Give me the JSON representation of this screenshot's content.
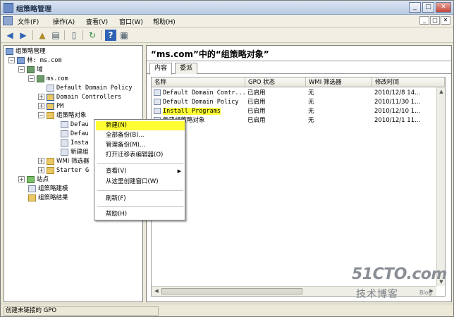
{
  "window": {
    "title": "组策略管理",
    "caption_min": "_",
    "caption_max": "□",
    "caption_close": "✕"
  },
  "menu": {
    "items": [
      "文件(F)",
      "操作(A)",
      "查看(V)",
      "窗口(W)",
      "帮助(H)"
    ],
    "mdi_min": "_",
    "mdi_max": "□",
    "mdi_close": "✕"
  },
  "tree": {
    "root": "组策略管理",
    "forest": "林: ms.com",
    "domains": "域",
    "domain": "ms.com",
    "default_policy": "Default Domain Policy",
    "domain_controllers": "Domain Controllers",
    "pm": "PM",
    "gpo_folder": "组策略对象",
    "child1": "Defau",
    "child2": "Defau",
    "child3": "Insta",
    "child4": "新建组",
    "wmi": "WMI 筛选器",
    "starter": "Starter G",
    "sites": "站点",
    "modeling": "组策略建模",
    "results": "组策略结果"
  },
  "right": {
    "heading": "“ms.com”中的“组策略对象”",
    "tabs": [
      "内容",
      "委派"
    ],
    "columns": [
      "名称",
      "GPO 状态",
      "WMI 筛选器",
      "修改时间"
    ],
    "rows": [
      {
        "name": "Default Domain Contr...",
        "status": "已启用",
        "wmi": "无",
        "time": "2010/12/8 14..."
      },
      {
        "name": "Default Domain Policy",
        "status": "已启用",
        "wmi": "无",
        "time": "2010/11/30 1..."
      },
      {
        "name": "Install Programs",
        "status": "已启用",
        "wmi": "无",
        "time": "2010/12/10 1..."
      },
      {
        "name": "新建组策略对象",
        "status": "已启用",
        "wmi": "无",
        "time": "2010/12/1 11..."
      }
    ]
  },
  "context_menu": {
    "items": [
      "新建(N)",
      "全部备份(B)...",
      "管理备份(M)...",
      "打开迁移表编辑器(O)",
      "查看(V)",
      "从这里创建窗口(W)",
      "刷新(F)",
      "帮助(H)"
    ],
    "submenu_arrow": "▶"
  },
  "status_bar": {
    "text": "创建未链接的 GPO"
  },
  "watermark": {
    "site": "51CTO.com",
    "tagline": "技术博客",
    "blog": "Blog"
  }
}
